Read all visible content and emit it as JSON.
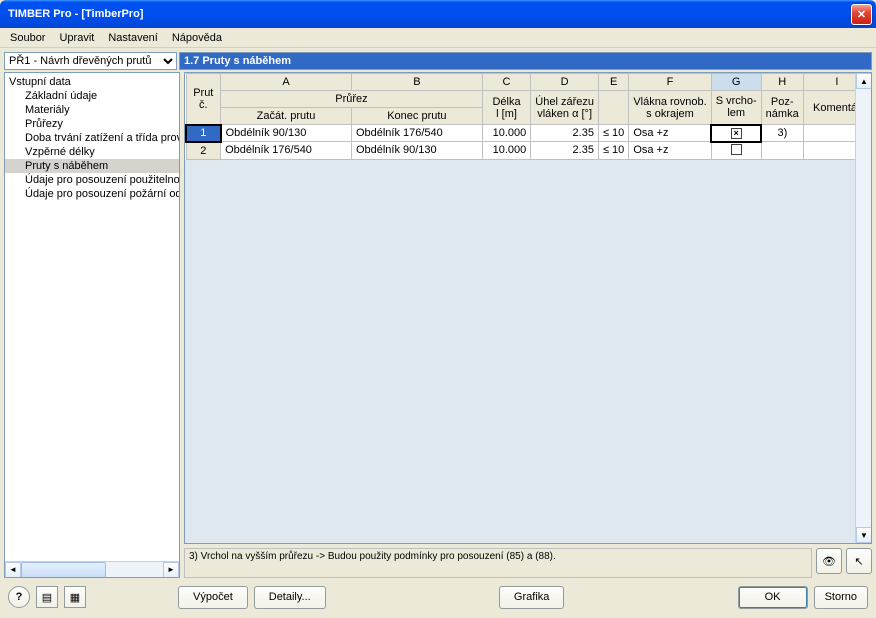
{
  "window": {
    "title": "TIMBER Pro - [TimberPro]"
  },
  "menu": [
    "Soubor",
    "Upravit",
    "Nastavení",
    "Nápověda"
  ],
  "selector": {
    "value": "PŘ1 - Návrh dřevěných prutů"
  },
  "section": {
    "title": "1.7 Pruty s náběhem"
  },
  "tree": {
    "root": "Vstupní data",
    "items": [
      "Základní údaje",
      "Materiály",
      "Průřezy",
      "Doba trvání zatížení a třída provozu",
      "Vzpěrné délky",
      "Pruty s náběhem",
      "Údaje pro posouzení použitelnosti",
      "Údaje pro posouzení požární odolnosti"
    ],
    "selected_index": 5
  },
  "grid": {
    "letters": [
      "A",
      "B",
      "C",
      "D",
      "E",
      "F",
      "G",
      "H",
      "I"
    ],
    "head": {
      "prut": "Prut\nč.",
      "prurez": "Průřez",
      "zacat": "Začát. prutu",
      "konec": "Konec prutu",
      "delka": "Délka\nl [m]",
      "uhel": "Úhel zářezu\nvláken α [°]",
      "blank": "",
      "vlakna": "Vlákna rovnob.\ns okrajem",
      "vrcho": "S vrcho-\nlem",
      "pozn": "Poz-\nnámka",
      "koment": "Komentář"
    },
    "rows": [
      {
        "n": "1",
        "a": "Obdélník 90/130",
        "b": "Obdélník 176/540",
        "c": "10.000",
        "d": "2.35",
        "e": "≤ 10",
        "f": "Osa +z",
        "g": true,
        "h": "3)",
        "i": ""
      },
      {
        "n": "2",
        "a": "Obdélník 176/540",
        "b": "Obdélník 90/130",
        "c": "10.000",
        "d": "2.35",
        "e": "≤ 10",
        "f": "Osa +z",
        "g": false,
        "h": "",
        "i": ""
      }
    ],
    "selected_cell": {
      "row": 0,
      "col": "g"
    }
  },
  "status": {
    "note": "3) Vrchol na vyšším průřezu -> Budou použity podmínky pro posouzení (85) a (88)."
  },
  "buttons": {
    "vypocet": "Výpočet",
    "detaily": "Detaily...",
    "grafika": "Grafika",
    "ok": "OK",
    "storno": "Storno"
  },
  "icons": {
    "help": "?",
    "eye": "👁",
    "pick": "↖"
  }
}
